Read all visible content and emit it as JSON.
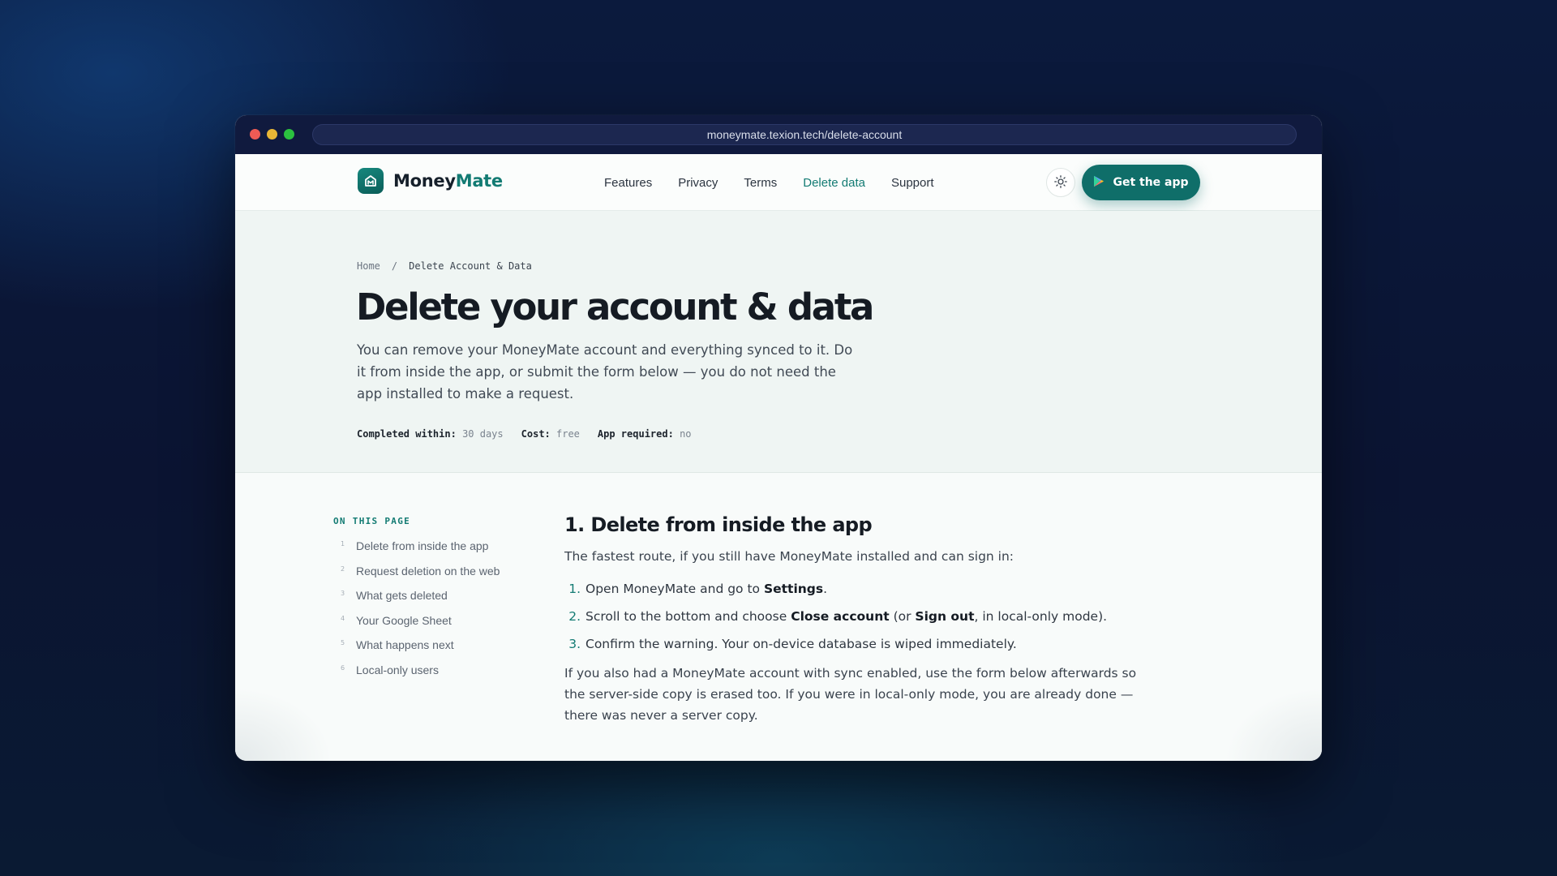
{
  "browser": {
    "url": "moneymate.texion.tech/delete-account"
  },
  "brand": {
    "name_primary": "Money",
    "name_accent": "Mate",
    "logo_icon": "piggy-bank-icon"
  },
  "nav": {
    "links": [
      {
        "label": "Features"
      },
      {
        "label": "Privacy"
      },
      {
        "label": "Terms"
      },
      {
        "label": "Delete data"
      },
      {
        "label": "Support"
      }
    ],
    "active": "Delete data",
    "theme_toggle_icon": "sun-icon",
    "cta_label": "Get the app",
    "cta_icon": "google-play-icon"
  },
  "breadcrumb": {
    "home": "Home",
    "separator": "/",
    "current": "Delete Account & Data"
  },
  "hero": {
    "title": "Delete your account & data",
    "lead": "You can remove your MoneyMate account and everything synced to it. Do it from inside the app, or submit the form below — you do not need the app installed to make a request.",
    "meta": [
      {
        "key": "Completed within:",
        "value": "30 days"
      },
      {
        "key": "Cost:",
        "value": "free"
      },
      {
        "key": "App required:",
        "value": "no"
      }
    ]
  },
  "toc": {
    "heading": "ON THIS PAGE",
    "items": [
      {
        "num": "1",
        "label": "Delete from inside the app"
      },
      {
        "num": "2",
        "label": "Request deletion on the web"
      },
      {
        "num": "3",
        "label": "What gets deleted"
      },
      {
        "num": "4",
        "label": "Your Google Sheet"
      },
      {
        "num": "5",
        "label": "What happens next"
      },
      {
        "num": "6",
        "label": "Local-only users"
      }
    ]
  },
  "section1": {
    "title": "1. Delete from inside the app",
    "intro": "The fastest route, if you still have MoneyMate installed and can sign in:",
    "steps": [
      {
        "num": "1.",
        "a": "Open MoneyMate and go to ",
        "b1": "Settings",
        "c": ".",
        "b2": "",
        "d": ""
      },
      {
        "num": "2.",
        "a": "Scroll to the bottom and choose ",
        "b1": "Close account",
        "c": " (or ",
        "b2": "Sign out",
        "d": ", in local-only mode)."
      },
      {
        "num": "3.",
        "a": "Confirm the warning. Your on-device database is wiped immediately.",
        "b1": "",
        "c": "",
        "b2": "",
        "d": ""
      }
    ],
    "closing": "If you also had a MoneyMate account with sync enabled, use the form below afterwards so the server-side copy is erased too. If you were in local-only mode, you are already done — there was never a server copy."
  },
  "colors": {
    "accent": "#137b73",
    "cta": "#0f6e69",
    "page_bg": "#0b1432",
    "hero_bg": "#eff5f3"
  }
}
